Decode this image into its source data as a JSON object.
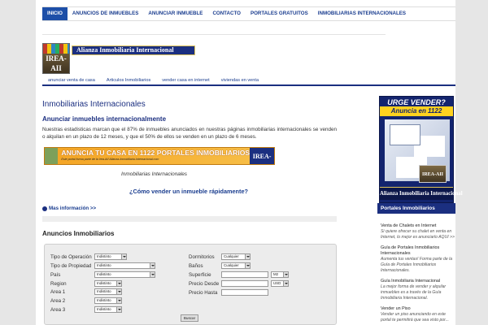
{
  "nav": {
    "items": [
      {
        "label": "INICIO",
        "active": true
      },
      {
        "label": "ANUNCIOS DE INMUEBLES",
        "active": false
      },
      {
        "label": "ANUNCIAR INMUEBLE",
        "active": false
      },
      {
        "label": "CONTACTO",
        "active": false
      },
      {
        "label": "PORTALES GRATUITOS",
        "active": false
      },
      {
        "label": "INMOBILIARIAS INTERNACIONALES",
        "active": false
      }
    ]
  },
  "brand": {
    "logo_text": "IREA-AII",
    "banner_text": "Alianza Inmobiliaria Internacional"
  },
  "subnav": {
    "items": [
      "anunciar venta de casa",
      "Articulos Inmobiliarios",
      "vender casa en internet",
      "viviendas en venta"
    ]
  },
  "main": {
    "title": "Inmobiliarias Internacionales",
    "subtitle": "Anunciar inmuebles internacionalmente",
    "paragraph": "Nuestras estadisticas marcan que  el 87% de inmuebles anunciados en nuestras páginas inmobiliarias internacionales se venden o alquilan en un plazo de 12 meses, y que el 50% de ellos se venden en un plazo de 6 meses.",
    "ad_main": "ANUNCIA TU CASA EN 1122 PORTALES INMOBILIARIOS",
    "ad_small": "Este portal forma parte de la Irea-AII Alianza-Inmobiliaria-Internacional.com",
    "ad_logo": "IREA-AII",
    "caption": "Inmobiliarias Internacionales",
    "how_link": "¿Cómo vender un inmueble rápidamente?",
    "more_link": "Mas información >>",
    "anuncios_title": "Anuncios Inmobiliarios"
  },
  "form": {
    "left": [
      {
        "label": "Tipo de Operación",
        "value": "Indistinto"
      },
      {
        "label": "Tipo de Propiedad",
        "value": "Indistinto"
      },
      {
        "label": "País",
        "value": "Indistinto"
      },
      {
        "label": "Region",
        "value": "Indistinto"
      },
      {
        "label": "Area 1",
        "value": "Indistinto"
      },
      {
        "label": "Area 2",
        "value": "Indistinto"
      },
      {
        "label": "Area 3",
        "value": "Indistinto"
      }
    ],
    "right": [
      {
        "label": "Dormitorios",
        "value": "Cualquier"
      },
      {
        "label": "Baños",
        "value": "Cualquier"
      },
      {
        "label": "Superficie",
        "unit": "M2"
      },
      {
        "label": "Precio Desde",
        "unit": "USD"
      },
      {
        "label": "Precio Hasta"
      }
    ],
    "button": "Buscar"
  },
  "sidebar": {
    "urge": "URGE VENDER?",
    "anuncia": "Anuncia en 1122 Portales",
    "logo_text": "IREA-AII",
    "alianza": "Alianza Inmobiliaria Internacional",
    "portales_header": "Portales Inmobiliarios Asociados",
    "items": [
      {
        "title": "Venta de Chalets en Internet",
        "desc": "Si quiere ofrecer su chalet en venta en Internet, lo mejor es anunciarlo AQUI >>"
      },
      {
        "title": "Guía de Portales Inmobiliarios Internacionales",
        "desc": "Aumenta tus ventas! Forma parte de la Guía de Portales Inmobiliarios Internacionales."
      },
      {
        "title": "Guía Inmobiliaria Internacional",
        "desc": "La mejor forma de vender y alquilar inmuebles es a través de la Guía Inmobiliaria Internacional."
      },
      {
        "title": "Vender un Piso",
        "desc": "Vender un piso anunciando en este portal te permitirá que sea visto por..."
      }
    ]
  }
}
